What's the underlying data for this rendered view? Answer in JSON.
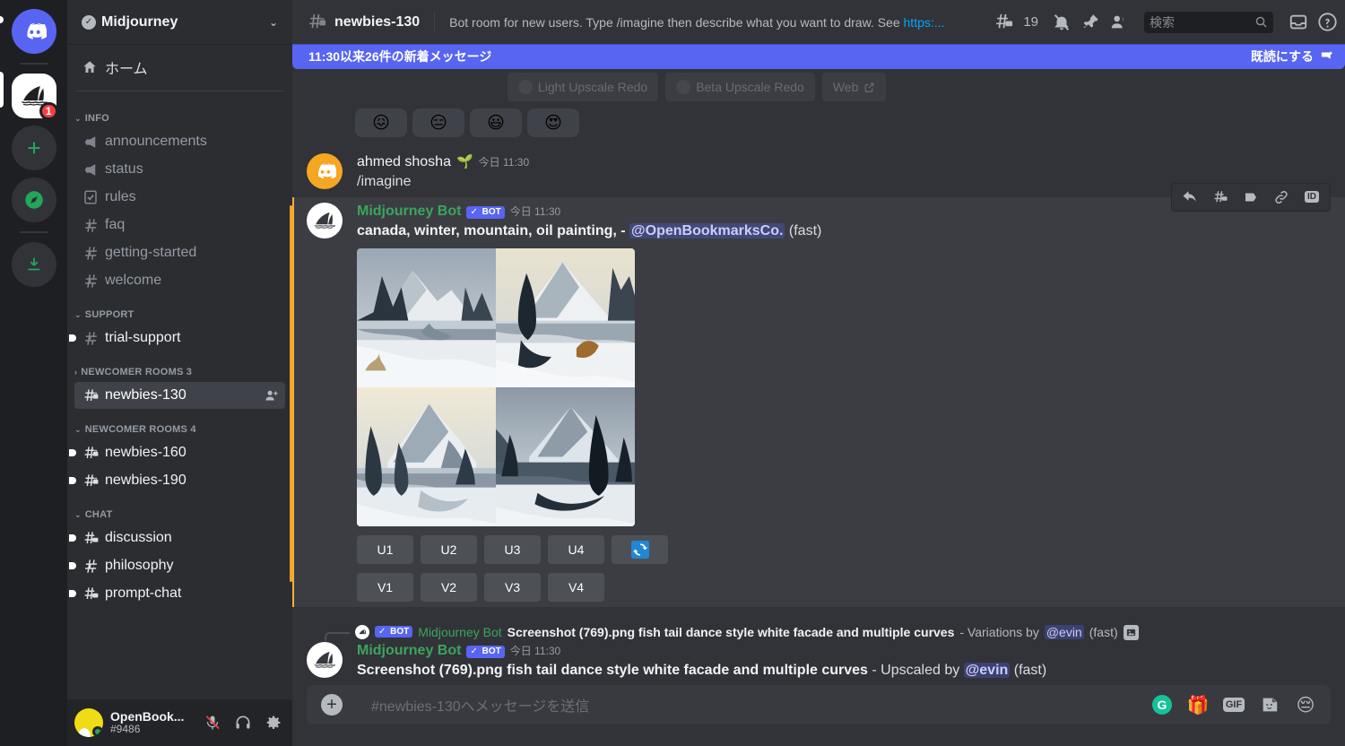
{
  "rail": {
    "servers": [
      {
        "name": "discord-home",
        "label": "Discord",
        "badge": ""
      },
      {
        "name": "midjourney-server",
        "label": "Midjourney",
        "badge": "1"
      }
    ],
    "actions": [
      {
        "name": "add-server",
        "glyph": "+"
      },
      {
        "name": "explore-servers",
        "glyph": "compass"
      },
      {
        "name": "download-apps",
        "glyph": "download"
      }
    ]
  },
  "sidebar": {
    "guild_name": "Midjourney",
    "home_label": "ホーム",
    "categories": [
      {
        "label": "INFO",
        "collapsed": false,
        "channels": [
          {
            "name": "announcements",
            "icon": "announcement",
            "state": "normal"
          },
          {
            "name": "status",
            "icon": "announcement",
            "state": "normal"
          },
          {
            "name": "rules",
            "icon": "rules",
            "state": "normal"
          },
          {
            "name": "faq",
            "icon": "hash",
            "state": "normal"
          },
          {
            "name": "getting-started",
            "icon": "hash",
            "state": "normal"
          },
          {
            "name": "welcome",
            "icon": "hash",
            "state": "normal"
          }
        ]
      },
      {
        "label": "SUPPORT",
        "collapsed": false,
        "channels": [
          {
            "name": "trial-support",
            "icon": "hash",
            "state": "unread"
          }
        ]
      },
      {
        "label": "NEWCOMER ROOMS 3",
        "collapsed": true,
        "channels": [
          {
            "name": "newbies-130",
            "icon": "hash-thread-lock",
            "state": "active",
            "action": "add-member"
          }
        ]
      },
      {
        "label": "NEWCOMER ROOMS 4",
        "collapsed": false,
        "channels": [
          {
            "name": "newbies-160",
            "icon": "hash-thread-lock",
            "state": "unread"
          },
          {
            "name": "newbies-190",
            "icon": "hash-thread-lock",
            "state": "unread"
          }
        ]
      },
      {
        "label": "CHAT",
        "collapsed": false,
        "channels": [
          {
            "name": "discussion",
            "icon": "hash-thread",
            "state": "unread"
          },
          {
            "name": "philosophy",
            "icon": "hash",
            "state": "unread"
          },
          {
            "name": "prompt-chat",
            "icon": "hash-thread",
            "state": "unread"
          }
        ]
      }
    ],
    "user": {
      "display_name": "OpenBook...",
      "tag": "#9486",
      "status": "online",
      "mic": "muted",
      "headphones": "on"
    }
  },
  "topbar": {
    "channel_name": "newbies-130",
    "topic_before": "Bot room for new users. Type /imagine then describe what you want to draw. See ",
    "topic_link": "https:...",
    "thread_count": "19",
    "search_placeholder": "検索",
    "icons": [
      "threads-icon",
      "notification-muted-icon",
      "pinned-messages-icon",
      "member-list-icon",
      "inbox-icon",
      "help-icon"
    ]
  },
  "new_messages_banner": {
    "text": "11:30以来26件の新着メッセージ",
    "mark_read_label": "既読にする",
    "color": "#5865f2"
  },
  "ghost_buttons": [
    {
      "label": "Light Upscale Redo"
    },
    {
      "label": "Beta Upscale Redo"
    },
    {
      "label": "Web"
    }
  ],
  "reactions": [
    {
      "emoji": "😖",
      "name": "confounded-reaction"
    },
    {
      "emoji": "😑",
      "name": "expressionless-reaction"
    },
    {
      "emoji": "😃",
      "name": "grinning-reaction"
    },
    {
      "emoji": "😍",
      "name": "heart-eyes-reaction"
    }
  ],
  "messages": [
    {
      "author": "ahmed shosha",
      "author_badge_emoji": "🌱",
      "is_bot": false,
      "timestamp": "今日 11:30",
      "text": "/imagine",
      "avatar": "orange-discord"
    },
    {
      "author": "Midjourney Bot",
      "bot_tag": "BOT",
      "is_bot": true,
      "timestamp": "今日 11:30",
      "prompt": "canada, winter, mountain, oil painting, -",
      "mention": "@OpenBookmarksCo.",
      "speed": "(fast)",
      "avatar": "midjourney-sail",
      "grid_alt": "2x2 grid of winter mountain oil paintings",
      "upscale_buttons": [
        "U1",
        "U2",
        "U3",
        "U4"
      ],
      "reroll_button": "reroll-icon",
      "variation_buttons": [
        "V1",
        "V2",
        "V3",
        "V4"
      ]
    }
  ],
  "hover_tools": [
    {
      "name": "reply-icon"
    },
    {
      "name": "create-thread-icon"
    },
    {
      "name": "mark-unread-icon"
    },
    {
      "name": "copy-link-icon"
    },
    {
      "name": "copy-id-icon",
      "label": "ID"
    }
  ],
  "reply_preview": {
    "bot_tag": "BOT",
    "author": "Midjourney Bot",
    "text": "Screenshot (769).png fish tail dance style white facade and multiple curves",
    "suffix": " - Variations by ",
    "mention": "@evin",
    "speed": "(fast)"
  },
  "last_message": {
    "author": "Midjourney Bot",
    "bot_tag": "BOT",
    "timestamp": "今日 11:30",
    "text": "Screenshot (769).png fish tail dance style white facade and multiple curves",
    "suffix": " - Upscaled by ",
    "mention": "@evin",
    "speed": "(fast)"
  },
  "composer": {
    "placeholder": "#newbies-130へメッセージを送信",
    "icons": [
      "grammarly-icon",
      "gift-icon",
      "gif-icon",
      "sticker-icon",
      "emoji-icon"
    ],
    "gif_label": "GIF"
  }
}
